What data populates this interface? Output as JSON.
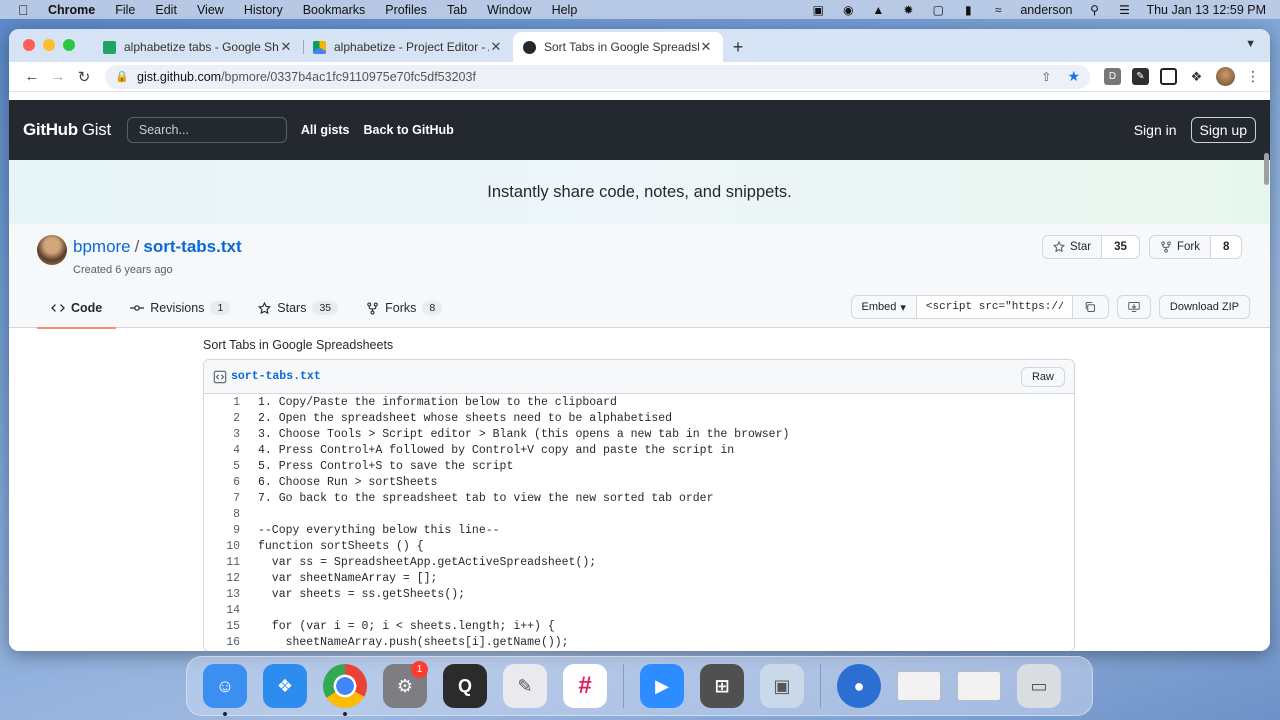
{
  "menubar": {
    "app": "Chrome",
    "items": [
      "File",
      "Edit",
      "View",
      "History",
      "Bookmarks",
      "Profiles",
      "Tab",
      "Window",
      "Help"
    ],
    "user": "anderson",
    "datetime": "Thu Jan 13  12:59 PM"
  },
  "browser": {
    "tabs": [
      {
        "label": "alphabetize tabs - Google Sheets",
        "favicon_color": "#1fa463"
      },
      {
        "label": "alphabetize - Project Editor - Apps Script",
        "favicon_color": "#f4b400"
      },
      {
        "label": "Sort Tabs in Google Spreadsheets",
        "favicon_color": "#24292f"
      }
    ],
    "url_host": "gist.github.com",
    "url_path": "/bpmore/0337b4ac1fc9110975e70fc5df53203f",
    "ext_d": "D"
  },
  "gh": {
    "logo": "GitHub",
    "logo_suffix": "Gist",
    "search_placeholder": "Search...",
    "nav_all_gists": "All gists",
    "nav_back": "Back to GitHub",
    "sign_in": "Sign in",
    "sign_up": "Sign up",
    "banner": "Instantly share code, notes, and snippets."
  },
  "gist": {
    "owner": "bpmore",
    "filename": "sort-tabs.txt",
    "created": "Created 6 years ago",
    "star_label": "Star",
    "star_count": "35",
    "fork_label": "Fork",
    "fork_count": "8",
    "tabs": [
      {
        "label": "Code",
        "count": ""
      },
      {
        "label": "Revisions",
        "count": "1"
      },
      {
        "label": "Stars",
        "count": "35"
      },
      {
        "label": "Forks",
        "count": "8"
      }
    ],
    "embed_label": "Embed",
    "embed_value": "<script src=\"https://",
    "download_zip": "Download ZIP",
    "description": "Sort Tabs in Google Spreadsheets",
    "raw": "Raw",
    "lines": [
      "1. Copy/Paste the information below to the clipboard",
      "2. Open the spreadsheet whose sheets need to be alphabetised",
      "3. Choose Tools > Script editor > Blank (this opens a new tab in the browser)",
      "4. Press Control+A followed by Control+V copy and paste the script in",
      "5. Press Control+S to save the script",
      "6. Choose Run > sortSheets",
      "7. Go back to the spreadsheet tab to view the new sorted tab order",
      "",
      "--Copy everything below this line--",
      "function sortSheets () {",
      "  var ss = SpreadsheetApp.getActiveSpreadsheet();",
      "  var sheetNameArray = [];",
      "  var sheets = ss.getSheets();",
      "",
      "  for (var i = 0; i < sheets.length; i++) {",
      "    sheetNameArray.push(sheets[i].getName());"
    ]
  },
  "dock": {
    "badge": "1",
    "apps": [
      {
        "name": "finder",
        "color": "#3b8ff0"
      },
      {
        "name": "safari",
        "color": "#2d8cf0"
      },
      {
        "name": "chrome",
        "color": "#ffffff"
      },
      {
        "name": "system-preferences",
        "color": "#7d7d82"
      },
      {
        "name": "quicktime",
        "color": "#2b2b2b"
      },
      {
        "name": "photo-editor",
        "color": "#e9e9ee"
      },
      {
        "name": "slack",
        "color": "#ffffff"
      },
      {
        "name": "zoom",
        "color": "#2d8cff"
      },
      {
        "name": "calculator",
        "color": "#505050"
      },
      {
        "name": "preview",
        "color": "#c9d9ea"
      },
      {
        "name": "network-globe",
        "color": "#2a6fd1"
      },
      {
        "name": "chrome-window-1",
        "color": "#f2f2f2"
      },
      {
        "name": "chrome-window-2",
        "color": "#f2f2f2"
      },
      {
        "name": "trash",
        "color": "#d9dde2"
      }
    ]
  }
}
